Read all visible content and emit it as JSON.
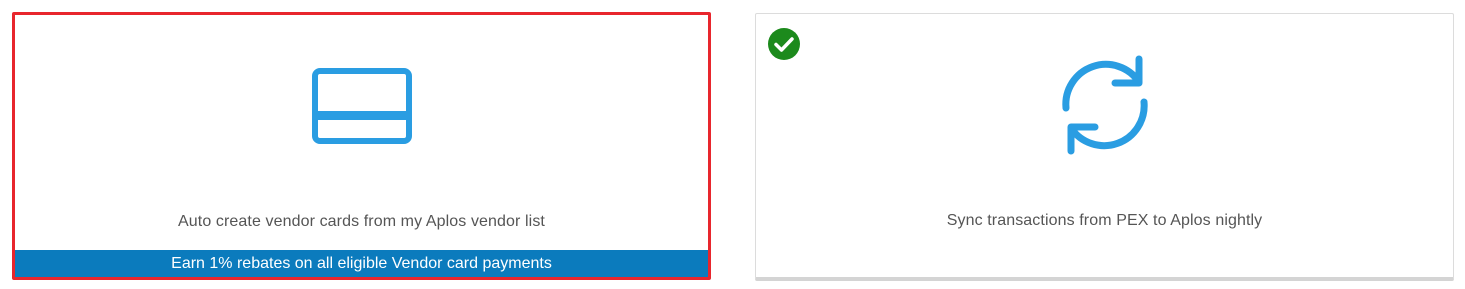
{
  "options": [
    {
      "label": "Auto create vendor cards from my Aplos vendor list",
      "banner": "Earn 1% rebates on all eligible Vendor card payments",
      "icon": "credit-card-icon",
      "selected": true
    },
    {
      "label": "Sync transactions from PEX to Aplos nightly",
      "icon": "sync-icon",
      "enabled": true,
      "status_icon": "checkmark-icon"
    }
  ],
  "colors": {
    "icon_blue": "#2a9de2",
    "banner_blue": "#0b7bbd",
    "selection_border": "#e8262d",
    "check_green": "#1c8a1c",
    "label_text": "#555555"
  }
}
